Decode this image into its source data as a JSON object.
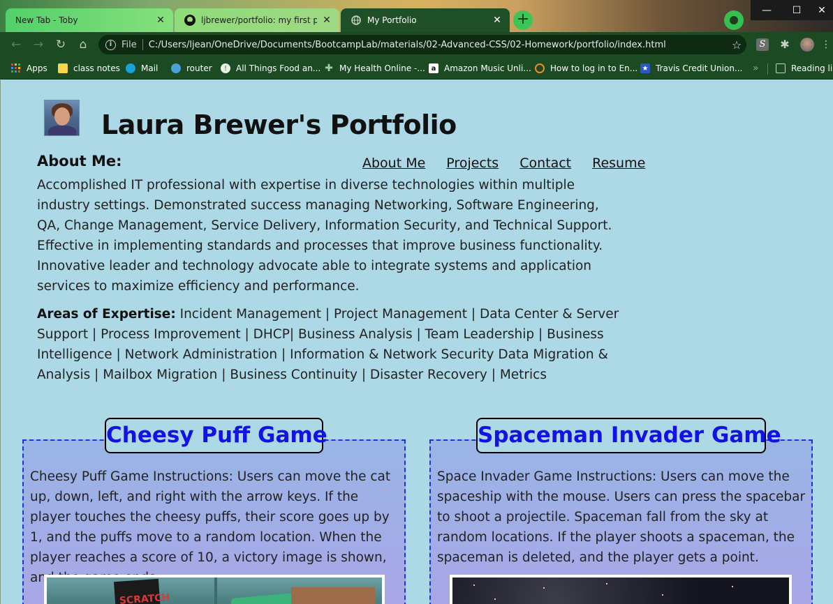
{
  "browser": {
    "tabs": [
      {
        "title": "New Tab - Toby",
        "favicon": "toby-icon"
      },
      {
        "title": "ljbrewer/portfolio: my first portfolio",
        "favicon": "github-icon"
      },
      {
        "title": "My Portfolio",
        "favicon": "globe-icon"
      }
    ],
    "new_tab_label": "+",
    "window_controls": {
      "minimize": "—",
      "maximize": "☐",
      "close": "✕"
    },
    "address": {
      "scheme_label": "File",
      "url": "C:/Users/ljean/OneDrive/Documents/BootcampLab/materials/02-Advanced-CSS/02-Homework/portfolio/index.html"
    },
    "bookmarks": [
      {
        "label": "Apps"
      },
      {
        "label": "class notes"
      },
      {
        "label": "Mail"
      },
      {
        "label": "router"
      },
      {
        "label": "All Things Food an..."
      },
      {
        "label": "My Health Online -..."
      },
      {
        "label": "Amazon Music Unli..."
      },
      {
        "label": "How to log in to En..."
      },
      {
        "label": "Travis Credit Union..."
      }
    ],
    "bookmarks_more": "»",
    "reading_list": "Reading list"
  },
  "page": {
    "title": "Laura Brewer's Portfolio",
    "nav": [
      {
        "label": "About Me"
      },
      {
        "label": "Projects"
      },
      {
        "label": "Contact"
      },
      {
        "label": "Resume"
      }
    ],
    "about": {
      "heading": "About Me:",
      "text": "Accomplished IT professional with expertise in diverse technologies within multiple industry settings. Demonstrated success managing Networking, Software Engineering, QA, Change Management, Service Delivery, Information Security, and Technical Support. Effective in implementing standards and processes that improve business functionality. Innovative leader and technology advocate able to integrate systems and application services to maximize efficiency and performance."
    },
    "expertise": {
      "label": "Areas of Expertise:",
      "text": " Incident Management | Project Management | Data Center & Server Support | Process Improvement | DHCP| Business Analysis | Team Leadership | Business Intelligence | Network Administration | Information & Network Security Data Migration & Analysis | Mailbox Migration | Business Continuity | Disaster Recovery | Metrics"
    },
    "projects": [
      {
        "title": "Cheesy Puff Game",
        "description": "Cheesy Puff Game Instructions: Users can move the cat up, down, left, and right with the arrow keys. If the player touches the cheesy puffs, their score goes up by 1, and the puffs move to a random location. When the player reaches a score of 10, a victory image is shown, and the game ends.",
        "image_text": "SCRATCH"
      },
      {
        "title": "Spaceman Invader Game",
        "description": "Space Invader Game Instructions: Users can move the spaceship with the mouse. Users can press the spacebar to shoot a projectile. Spaceman fall from the sky at random locations. If the player shoots a spaceman, the spaceman is deleted, and the player gets a point."
      }
    ]
  },
  "colors": {
    "page_background": "#add8e6",
    "project_title_text": "#1212e6",
    "project_border": "#1a34d9",
    "browser_chrome": "#1c4a23"
  }
}
